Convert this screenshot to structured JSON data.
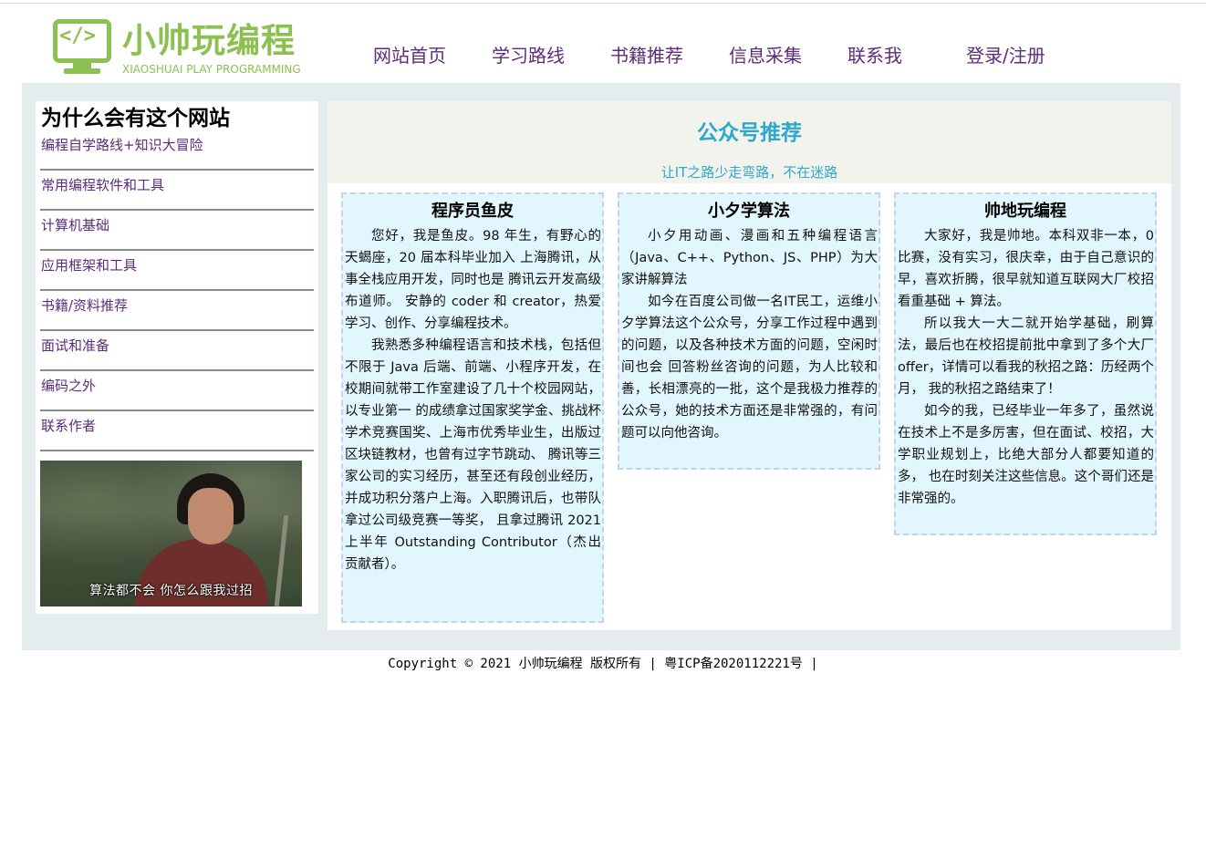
{
  "header": {
    "logo": {
      "code_glyph": "</>",
      "title": "小帅玩编程",
      "subtitle": "XIAOSHUAI PLAY PROGRAMMING",
      "color": "#8cc152"
    },
    "nav": [
      {
        "label": "网站首页"
      },
      {
        "label": "学习路线"
      },
      {
        "label": "书籍推荐"
      },
      {
        "label": "信息采集"
      },
      {
        "label": "联系我"
      },
      {
        "label": "登录/注册"
      }
    ],
    "nav_color": "#5b2d7c"
  },
  "sidebar": {
    "title": "为什么会有这个网站",
    "items": [
      {
        "label": "编程自学路线+知识大冒险"
      },
      {
        "label": "常用编程软件和工具"
      },
      {
        "label": "计算机基础"
      },
      {
        "label": "应用框架和工具"
      },
      {
        "label": "书籍/资料推荐"
      },
      {
        "label": "面试和准备"
      },
      {
        "label": "编码之外"
      },
      {
        "label": "联系作者"
      }
    ],
    "image": {
      "caption": "算法都不会 你怎么跟我过招"
    }
  },
  "main": {
    "title": "公众号推荐",
    "subtitle": "让IT之路少走弯路，不在迷路",
    "accent_color": "#2ea9c9",
    "cards": [
      {
        "title": "程序员鱼皮",
        "paragraphs": [
          "您好，我是鱼皮。98 年生，有野心的天蝎座，20 届本科毕业加入 上海腾讯，从事全栈应用开发，同时也是 腾讯云开发高级布道师。 安静的 coder 和 creator，热爱学习、创作、分享编程技术。",
          "我熟悉多种编程语言和技术栈，包括但不限于 Java 后端、前端、小程序开发，在校期间就带工作室建设了几十个校园网站， 以专业第一 的成绩拿过国家奖学金、挑战杯学术竞赛国奖、上海市优秀毕业生，出版过区块链教材，也曾有过字节跳动、 腾讯等三家公司的实习经历，甚至还有段创业经历，并成功积分落户上海。入职腾讯后，也带队拿过公司级竞赛一等奖， 且拿过腾讯 2021 上半年 Outstanding Contributor（杰出贡献者）。"
        ]
      },
      {
        "title": "小夕学算法",
        "paragraphs": [
          "小夕用动画、漫画和五种编程语言（Java、C++、Python、JS、PHP）为大家讲解算法",
          "如今在百度公司做一名IT民工，运维小夕学算法这个公众号，分享工作过程中遇到的问题，以及各种技术方面的问题，空闲时间也会 回答粉丝咨询的问题，为人比较和善，长相漂亮的一批，这个是我极力推荐的公众号，她的技术方面还是非常强的，有问题可以向他咨询。"
        ]
      },
      {
        "title": "帅地玩编程",
        "paragraphs": [
          "大家好，我是帅地。本科双非一本，0 比赛，没有实习，很庆幸，由于自己意识的早，喜欢折腾，很早就知道互联网大厂校招看重基础 + 算法。",
          "所以我大一大二就开始学基础，刷算法，最后也在校招提前批中拿到了多个大厂 offer，详情可以看我的秋招之路：历经两个月， 我的秋招之路结束了！",
          "如今的我，已经毕业一年多了，虽然说在技术上不是多厉害，但在面试、校招，大学职业规划上，比绝大部分人都要知道的多， 也在时刻关注这些信息。这个哥们还是非常强的。"
        ]
      }
    ]
  },
  "footer": {
    "text": "Copyright © 2021 小帅玩编程 版权所有 | 粤ICP备2020112221号 |"
  }
}
